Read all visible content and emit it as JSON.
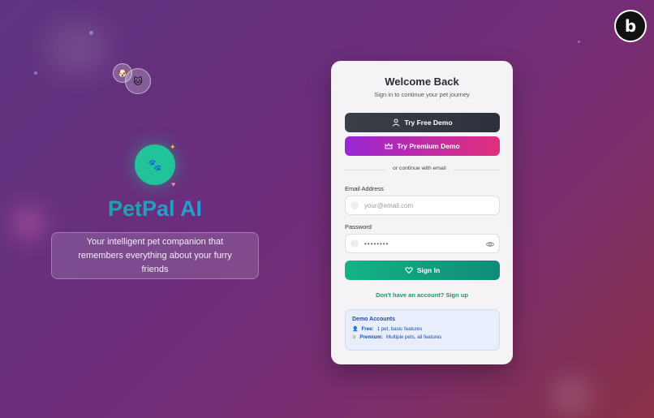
{
  "brand": {
    "name": "PetPal AI",
    "tagline": "Your intelligent pet companion that remembers everything about your furry friends"
  },
  "badge": {
    "letter": "b"
  },
  "login": {
    "title": "Welcome Back",
    "subtitle": "Sign in to continue your pet journey",
    "free_demo_label": "Try Free Demo",
    "premium_demo_label": "Try Premium Demo",
    "divider_text": "or continue with email",
    "email_label": "Email Address",
    "email_placeholder": "your@email.com",
    "password_label": "Password",
    "password_value": "••••••••",
    "signin_label": "Sign In",
    "signup_text": "Don't have an account? Sign up"
  },
  "demo_accounts": {
    "title": "Demo Accounts",
    "free_label": "Free:",
    "free_desc": "1 pet, basic features",
    "premium_label": "Premium:",
    "premium_desc": "Multiple pets, all features"
  },
  "colors": {
    "accent_green": "#15b384",
    "premium_purple": "#9a27d6",
    "premium_pink": "#e0307a",
    "dark_button": "#2c313b"
  }
}
